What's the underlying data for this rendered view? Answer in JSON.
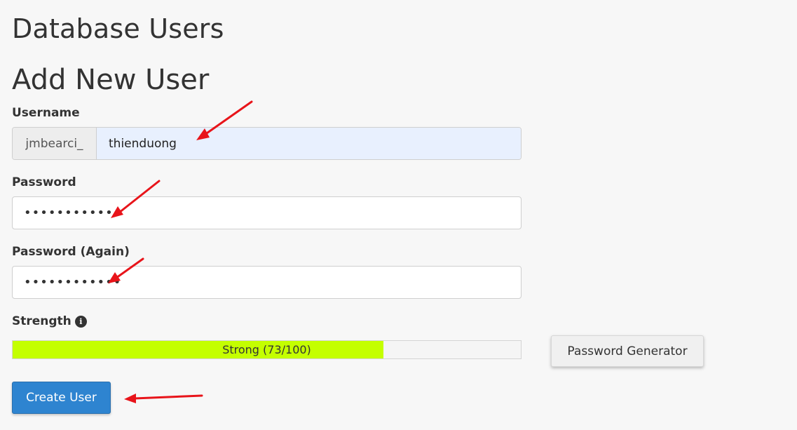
{
  "page": {
    "title": "Database Users",
    "section_title": "Add New User"
  },
  "form": {
    "username_label": "Username",
    "username_prefix": "jmbearci_",
    "username_value": "thienduong",
    "password_label": "Password",
    "password_value": "••••••••••••",
    "password_again_label": "Password (Again)",
    "password_again_value": "••••••••••••",
    "strength_label": "Strength",
    "strength_info_icon": "i",
    "strength_text": "Strong (73/100)",
    "strength_score": 73,
    "strength_max": 100,
    "password_generator_label": "Password Generator",
    "create_button_label": "Create User"
  },
  "colors": {
    "strength_fill": "#c4ff00",
    "primary_button": "#2e84d0",
    "annotation_arrow": "#e8141a"
  },
  "icons": {
    "info": "info-icon",
    "annotation": "red-arrow-icon"
  }
}
